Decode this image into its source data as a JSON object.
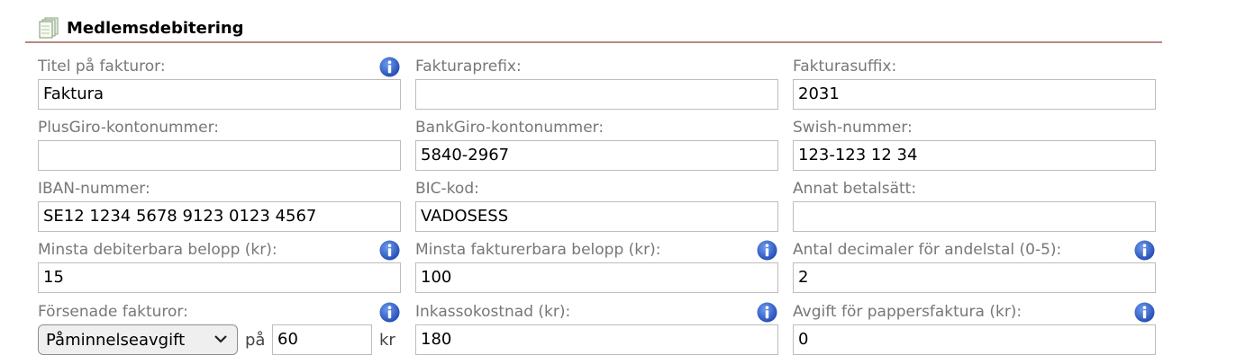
{
  "section": {
    "title": "Medlemsdebitering",
    "icon": "document-stack-icon"
  },
  "icons": {
    "info": "info-icon",
    "chevron": "chevron-down-icon"
  },
  "colors": {
    "info_blue": "#2f5fc0",
    "header_rule": "#b58a82",
    "label_gray": "#777777",
    "field_border": "#bdbdbd"
  },
  "row1": {
    "titel": {
      "label": "Titel på fakturor:",
      "value": "Faktura"
    },
    "prefix": {
      "label": "Fakturaprefix:",
      "value": ""
    },
    "suffix": {
      "label": "Fakturasuffix:",
      "value": "2031"
    }
  },
  "row2": {
    "plusgiro": {
      "label": "PlusGiro-kontonummer:",
      "value": ""
    },
    "bankgiro": {
      "label": "BankGiro-kontonummer:",
      "value": "5840-2967"
    },
    "swish": {
      "label": "Swish-nummer:",
      "value": "123-123 12 34"
    }
  },
  "row3": {
    "iban": {
      "label": "IBAN-nummer:",
      "value": "SE12 1234 5678 9123 0123 4567"
    },
    "bic": {
      "label": "BIC-kod:",
      "value": "VADOSESS"
    },
    "annat": {
      "label": "Annat betalsätt:",
      "value": ""
    }
  },
  "row4": {
    "minsta_deb": {
      "label": "Minsta debiterbara belopp (kr):",
      "value": "15"
    },
    "minsta_fakt": {
      "label": "Minsta fakturerbara belopp (kr):",
      "value": "100"
    },
    "decimaler": {
      "label": "Antal decimaler för andelstal (0-5):",
      "value": "2"
    }
  },
  "row5": {
    "forsenade": {
      "label": "Försenade fakturor:",
      "selected": "Påminnelseavgift",
      "pa": "på",
      "amount": "60",
      "unit": "kr"
    },
    "inkasso": {
      "label": "Inkassokostnad (kr):",
      "value": "180"
    },
    "pappers": {
      "label": "Avgift för pappersfaktura (kr):",
      "value": "0"
    }
  }
}
